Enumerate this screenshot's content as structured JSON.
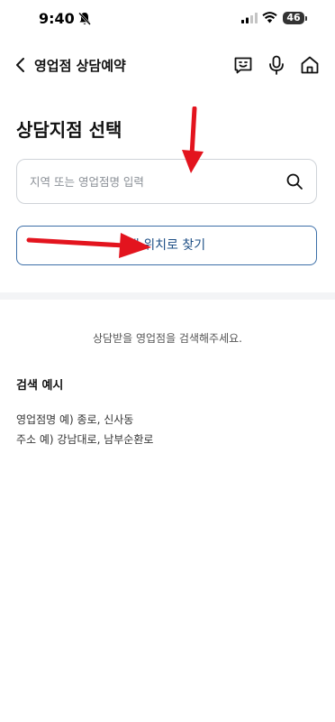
{
  "status_bar": {
    "time": "9:40",
    "battery": "46"
  },
  "nav": {
    "title": "영업점 상담예약"
  },
  "page": {
    "section_title": "상담지점 선택",
    "search": {
      "placeholder": "지역 또는 영업점명 입력",
      "value": ""
    },
    "locate_button": "내 위치로 찾기",
    "hint": "상담받을 영업점을 검색해주세요.",
    "examples_title": "검색 예시",
    "examples": [
      "영업점명 예) 종로, 신사동",
      "주소 예) 강남대로, 남부순환로"
    ]
  },
  "colors": {
    "annotation_arrow": "#e3141e",
    "accent": "#1e4f86"
  }
}
